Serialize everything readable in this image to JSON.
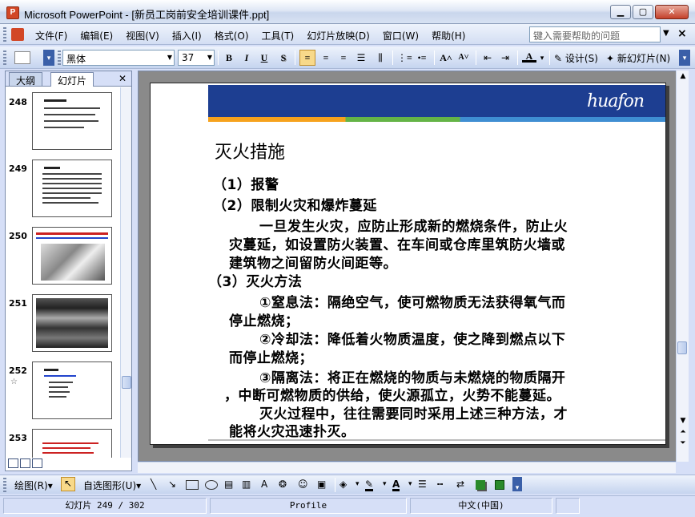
{
  "window": {
    "title": "Microsoft PowerPoint - [新员工岗前安全培训课件.ppt]",
    "app_icon": "P",
    "buttons": {
      "minimize": "▁",
      "maximize": "▢",
      "close": "✕"
    }
  },
  "menubar": {
    "items": [
      "文件(F)",
      "编辑(E)",
      "视图(V)",
      "插入(I)",
      "格式(O)",
      "工具(T)",
      "幻灯片放映(D)",
      "窗口(W)",
      "帮助(H)"
    ],
    "help_placeholder": "键入需要帮助的问题",
    "help_arrow": "▼",
    "doc_close": "×"
  },
  "toolbar": {
    "font_name": "黑体",
    "font_size": "37",
    "bold": "B",
    "italic": "I",
    "underline": "U",
    "shadow": "S",
    "design_label": "设计(S)",
    "new_slide_label": "新幻灯片(N)",
    "dropdown_arrow": "▾"
  },
  "left_pane": {
    "tabs": [
      "大纲",
      "幻灯片"
    ],
    "active_tab": "幻灯片",
    "close": "✕",
    "thumbnails": [
      {
        "number": "248",
        "selected": false
      },
      {
        "number": "249",
        "selected": false
      },
      {
        "number": "250",
        "selected": false
      },
      {
        "number": "251",
        "selected": false
      },
      {
        "number": "252",
        "selected": false,
        "has_icon": "☆"
      },
      {
        "number": "253",
        "selected": false
      }
    ]
  },
  "slide": {
    "logo": "huafon",
    "title": "灭火措施",
    "lines": [
      "（1）报警",
      "（2）限制火灾和爆炸蔓延",
      "一旦发生火灾，应防止形成新的燃烧条件，防止火",
      "灾蔓延，如设置防火装置、在车间或仓库里筑防火墙或",
      "建筑物之间留防火间距等。",
      "（3）灭火方法",
      "①窒息法：隔绝空气，使可燃物质无法获得氧气而",
      "停止燃烧；",
      "②冷却法：降低着火物质温度，使之降到燃点以下",
      "而停止燃烧；",
      "③隔离法：将正在燃烧的物质与未燃烧的物质隔开",
      "，中断可燃物质的供给，使火源孤立，火势不能蔓延。",
      "灭火过程中，往往需要同时采用上述三种方法，才",
      "能将火灾迅速扑灭。"
    ],
    "colors": {
      "header": "#1d3e91",
      "stripe_orange": "#f6a21d",
      "stripe_green": "#64b446",
      "stripe_blue": "#3f8ed2"
    }
  },
  "drawbar": {
    "draw_label": "绘图(R)",
    "autoshapes_label": "自选图形(U)",
    "arrow": "▾"
  },
  "statusbar": {
    "slide_info": "幻灯片 249 / 302",
    "template": "Profile",
    "language": "中文(中国)"
  }
}
